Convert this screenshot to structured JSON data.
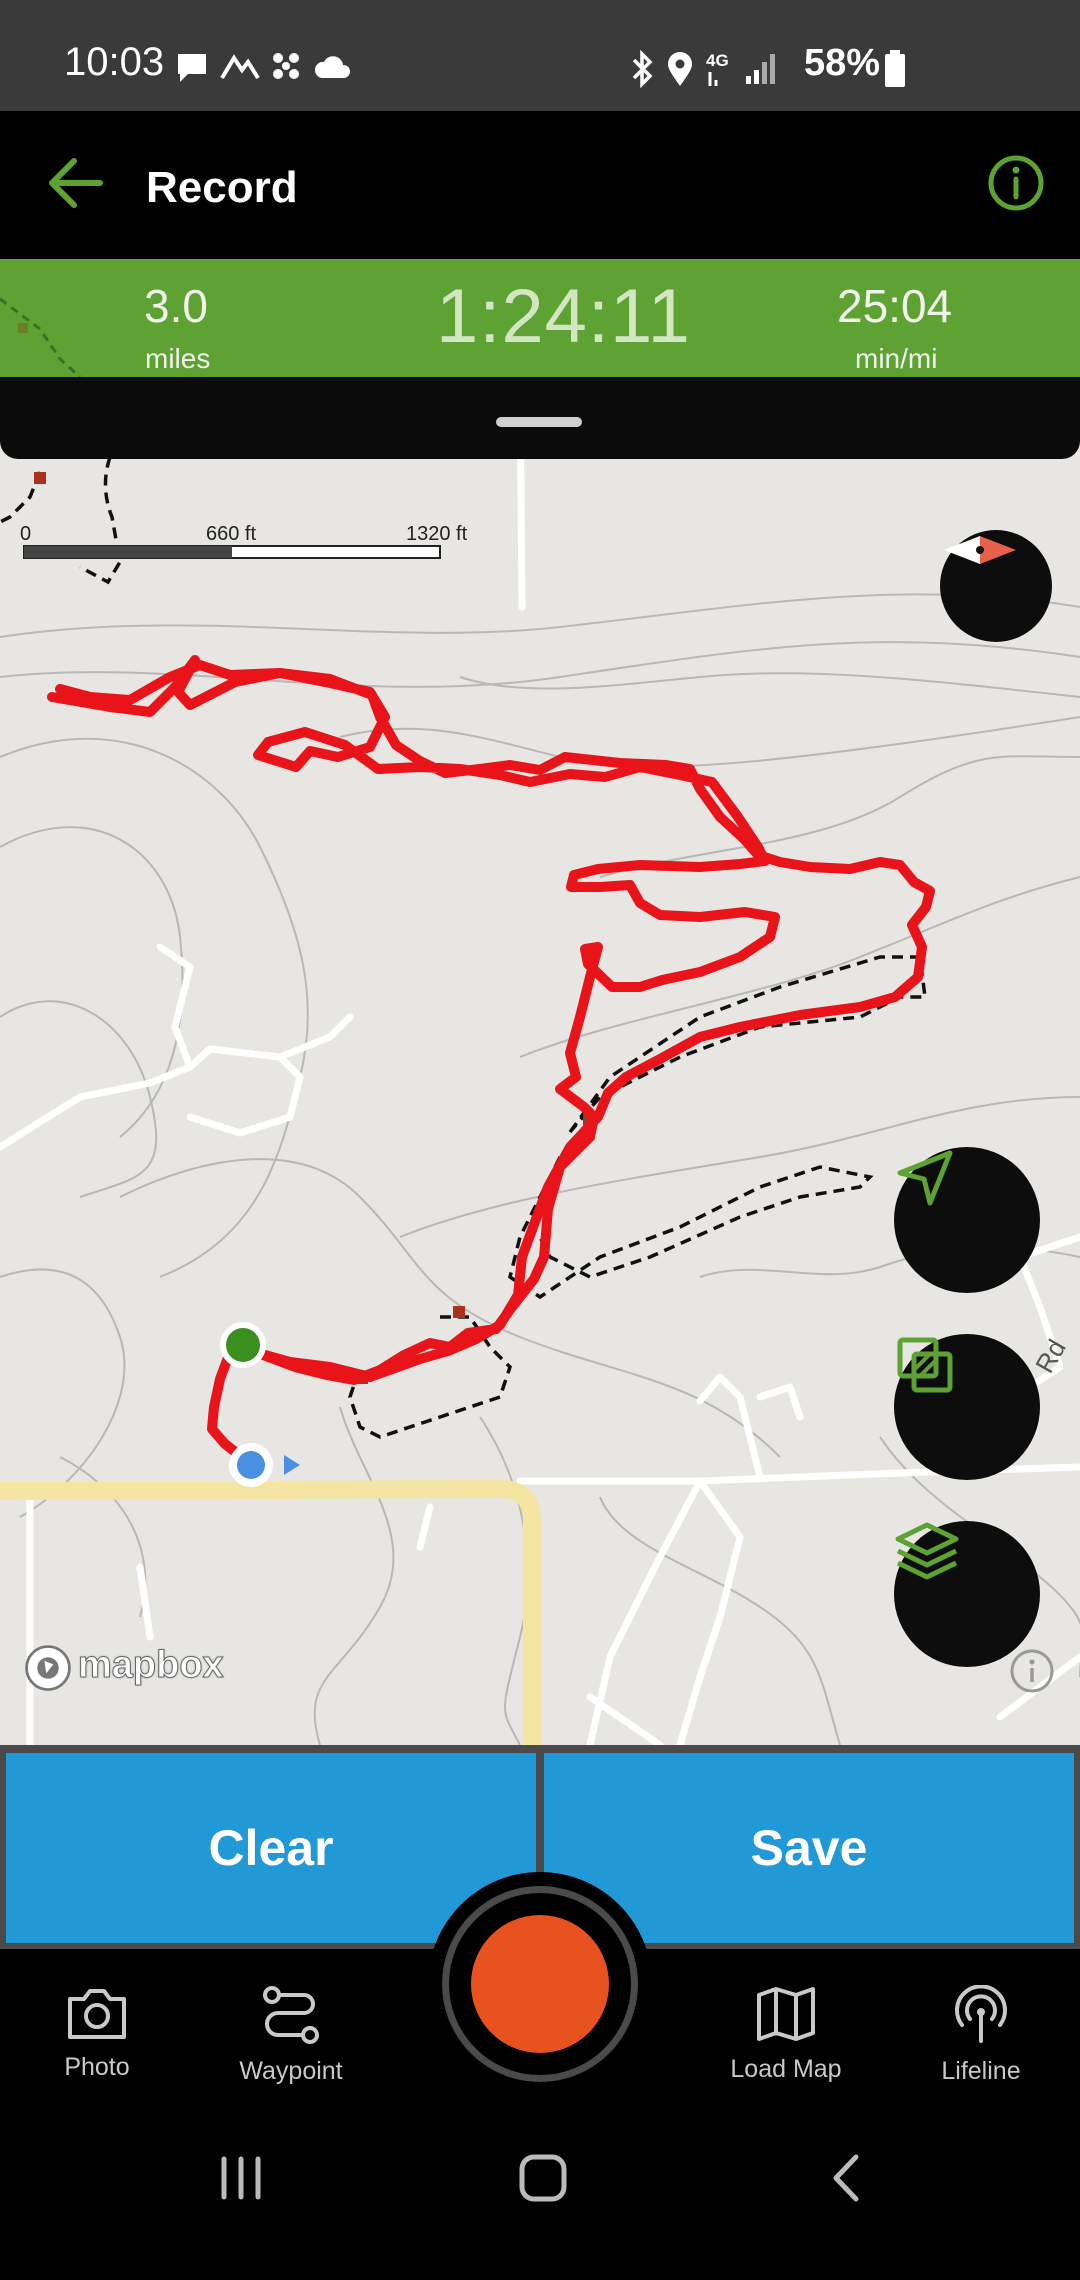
{
  "status_bar": {
    "time": "10:03",
    "battery": "58%",
    "network": "4G"
  },
  "header": {
    "title": "Record",
    "back_icon": "arrow-left-icon",
    "info_icon": "info-icon"
  },
  "stats": {
    "distance_value": "3.0",
    "distance_unit": "miles",
    "elapsed": "1:24:11",
    "pace_value": "25:04",
    "pace_unit": "min/mi"
  },
  "map": {
    "scale_labels": [
      "0",
      "660 ft",
      "1320 ft"
    ],
    "attribution": "mapbox",
    "road_label": "Rd",
    "track_color": "#e8141a",
    "start_color": "#3a8f1f",
    "current_location_color": "#4a90e2"
  },
  "actions": {
    "clear_label": "Clear",
    "save_label": "Save"
  },
  "nav": {
    "items": [
      {
        "label": "Photo",
        "icon": "camera-icon"
      },
      {
        "label": "Waypoint",
        "icon": "waypoint-icon"
      },
      {
        "label": "Load Map",
        "icon": "map-icon"
      },
      {
        "label": "Lifeline",
        "icon": "lifeline-icon"
      }
    ]
  },
  "colors": {
    "accent_green": "#5da233",
    "button_blue": "#2299d7",
    "record_orange": "#e8521f"
  }
}
